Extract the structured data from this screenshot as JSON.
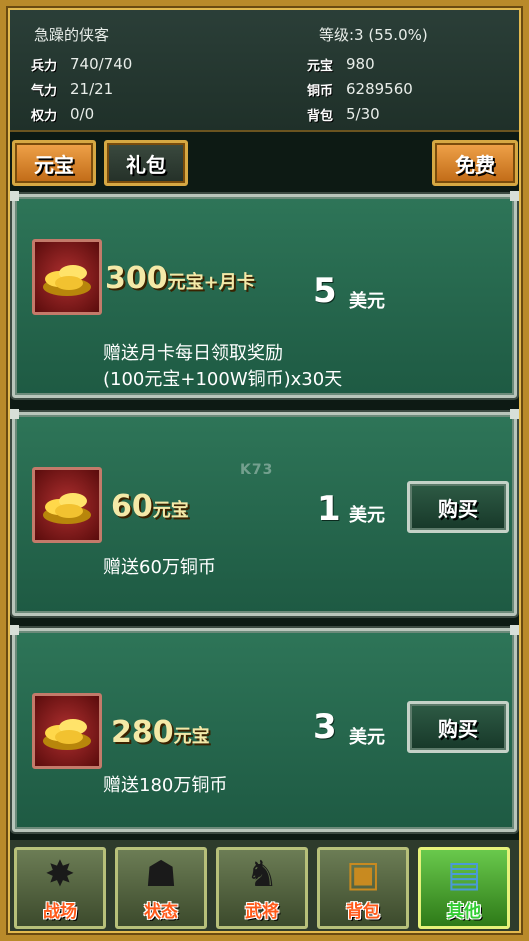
{
  "player": {
    "name": "急躁的侠客",
    "level": "等级:3 (55.0%)"
  },
  "stats_left": [
    {
      "label": "兵力",
      "value": "740/740",
      "color": "#c01818"
    },
    {
      "label": "气力",
      "value": "21/21",
      "color": "#c01818"
    },
    {
      "label": "权力",
      "value": "0/0",
      "color": "#1a9a2a"
    }
  ],
  "stats_right": [
    {
      "label": "元宝",
      "value": "980",
      "color": "#c01818"
    },
    {
      "label": "铜币",
      "value": "6289560",
      "color": "#1f4fb0"
    },
    {
      "label": "背包",
      "value": "5/30",
      "color": "#1a9a2a"
    }
  ],
  "tabs": {
    "yuanbao": "元宝",
    "gift": "礼包",
    "free": "免费"
  },
  "offers": [
    {
      "title_main": "300",
      "title_suffix": "元宝+月卡",
      "price": "5",
      "currency": "美元",
      "desc_line1": "赠送月卡每日领取奖励",
      "desc_line2": "(100元宝+100W铜币)x30天",
      "buy_label": ""
    },
    {
      "title_main": "60",
      "title_suffix": "元宝",
      "price": "1",
      "currency": "美元",
      "desc_line1": "赠送60万铜币",
      "desc_line2": "",
      "buy_label": "购买"
    },
    {
      "title_main": "280",
      "title_suffix": "元宝",
      "price": "3",
      "currency": "美元",
      "desc_line1": "赠送180万铜币",
      "desc_line2": "",
      "buy_label": "购买"
    }
  ],
  "watermark": "K73",
  "nav": [
    {
      "label": "战场",
      "icon": "battle-icon"
    },
    {
      "label": "状态",
      "icon": "status-icon"
    },
    {
      "label": "武将",
      "icon": "general-icon"
    },
    {
      "label": "背包",
      "icon": "chest-icon"
    },
    {
      "label": "其他",
      "icon": "scroll-icon"
    }
  ],
  "colors": {
    "card": "#2e7558",
    "gold": "#d6a843",
    "active_tab": "#e08a2e"
  }
}
